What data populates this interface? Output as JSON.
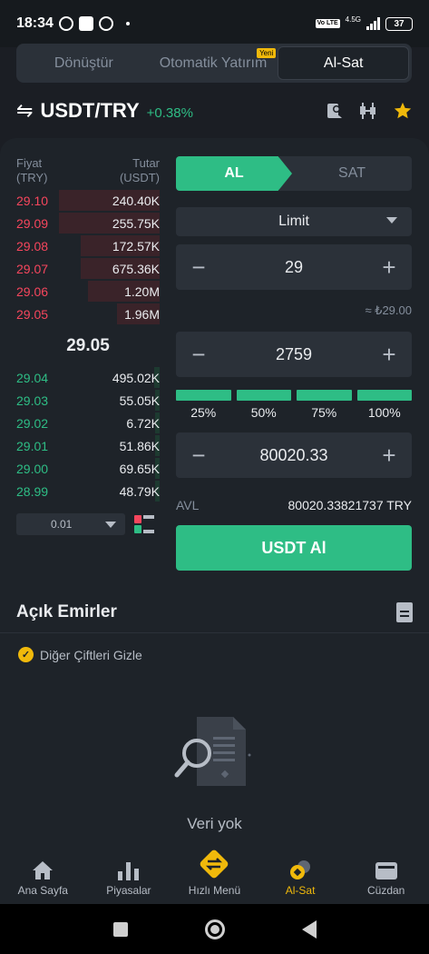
{
  "status_bar": {
    "time": "18:34",
    "volte": "Vo LTE",
    "network": "4.5G",
    "battery": "37"
  },
  "top_tabs": [
    {
      "label": "Dönüştür",
      "active": false
    },
    {
      "label": "Otomatik Yatırım",
      "active": false,
      "badge": "Yeni"
    },
    {
      "label": "Al-Sat",
      "active": true
    }
  ],
  "pair": {
    "symbol": "USDT/TRY",
    "change": "+0.38%"
  },
  "order_book": {
    "price_header": "Fiyat",
    "price_unit": "(TRY)",
    "amount_header": "Tutar",
    "amount_unit": "(USDT)",
    "asks": [
      {
        "price": "29.10",
        "amount": "240.40K",
        "depth": 0.7
      },
      {
        "price": "29.09",
        "amount": "255.75K",
        "depth": 0.7
      },
      {
        "price": "29.08",
        "amount": "172.57K",
        "depth": 0.55
      },
      {
        "price": "29.07",
        "amount": "675.36K",
        "depth": 0.55
      },
      {
        "price": "29.06",
        "amount": "1.20M",
        "depth": 0.5
      },
      {
        "price": "29.05",
        "amount": "1.96M",
        "depth": 0.3
      }
    ],
    "mid_price": "29.05",
    "bids": [
      {
        "price": "29.04",
        "amount": "495.02K",
        "depth": 0.04
      },
      {
        "price": "29.03",
        "amount": "55.05K",
        "depth": 0.03
      },
      {
        "price": "29.02",
        "amount": "6.72K",
        "depth": 0.03
      },
      {
        "price": "29.01",
        "amount": "51.86K",
        "depth": 0.03
      },
      {
        "price": "29.00",
        "amount": "69.65K",
        "depth": 0.03
      },
      {
        "price": "28.99",
        "amount": "48.79K",
        "depth": 0.03
      }
    ],
    "decimals": "0.01"
  },
  "form": {
    "buy_label": "AL",
    "sell_label": "SAT",
    "order_type": "Limit",
    "price": "29",
    "price_approx": "≈ ₺29.00",
    "amount": "2759",
    "percentages": [
      "25%",
      "50%",
      "75%",
      "100%"
    ],
    "total": "80020.33",
    "avl_label": "AVL",
    "avl_value": "80020.33821737 TRY",
    "submit_label": "USDT Al",
    "minus": "−",
    "plus": "+"
  },
  "orders": {
    "title": "Açık Emirler",
    "hide_pairs": "Diğer Çiftleri Gizle",
    "empty": "Veri yok"
  },
  "bottom_nav": [
    {
      "label": "Ana Sayfa",
      "icon": "home-icon",
      "active": false
    },
    {
      "label": "Piyasalar",
      "icon": "markets-icon",
      "active": false
    },
    {
      "label": "Hızlı Menü",
      "icon": "quick-menu-icon",
      "active": false
    },
    {
      "label": "Al-Sat",
      "icon": "trade-icon",
      "active": true
    },
    {
      "label": "Cüzdan",
      "icon": "wallet-icon",
      "active": false
    }
  ],
  "colors": {
    "buy": "#2ebd85",
    "sell": "#f6465d",
    "accent": "#f0b90b",
    "background": "#1b1e24"
  }
}
